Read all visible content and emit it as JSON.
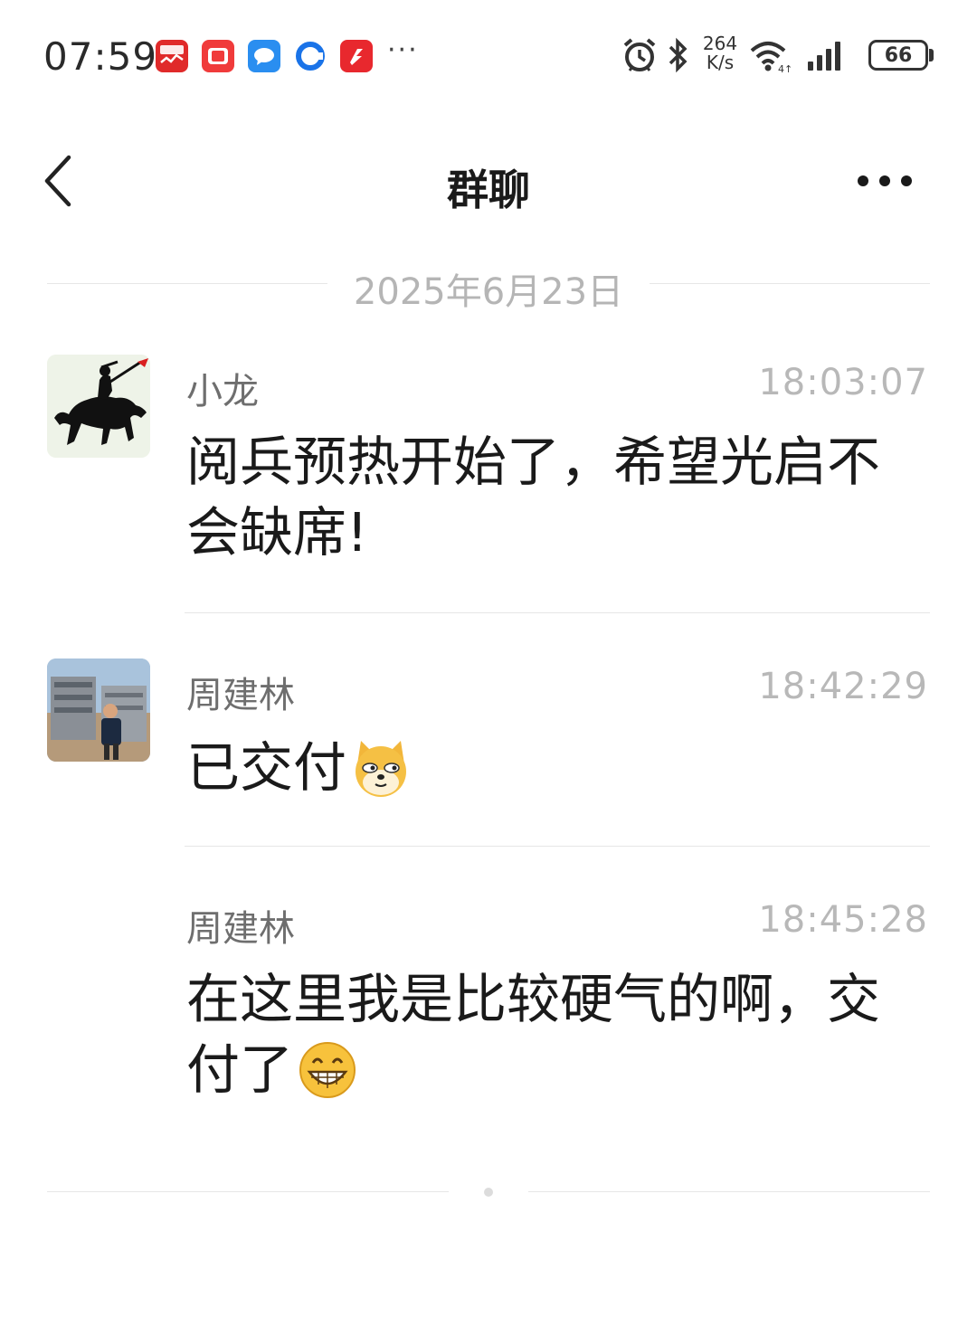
{
  "status_bar": {
    "time": "07:59",
    "net_speed_value": "264",
    "net_speed_unit": "K/s",
    "battery": "66",
    "more_notifications": "···",
    "app_icons": [
      {
        "name": "stock-app-icon",
        "color": "#e02a2a",
        "label": "选股"
      },
      {
        "name": "red-book-app-icon",
        "color": "#f03b3b",
        "label": ""
      },
      {
        "name": "message-app-icon",
        "color": "#2a8ef0",
        "label": ""
      },
      {
        "name": "browser-app-icon",
        "color": "#1a73e8",
        "label": ""
      },
      {
        "name": "news-app-icon",
        "color": "#e8282e",
        "label": ""
      }
    ]
  },
  "header": {
    "title": "群聊",
    "back_icon": "chevron-left-icon",
    "more_icon": "more-dots-icon"
  },
  "date_divider": "2025年6月23日",
  "messages": [
    {
      "sender": "小龙",
      "time": "18:03:07",
      "text": "阅兵预热开始了，希望光启不会缺席!",
      "avatar": "horse-rider-avatar"
    },
    {
      "sender": "周建林",
      "time": "18:42:29",
      "text": "已交付",
      "emoji": "doge-emoji",
      "avatar": "person-factory-avatar"
    },
    {
      "sender": "周建林",
      "time": "18:45:28",
      "text": "在这里我是比较硬气的啊，交付了",
      "emoji": "grin-emoji"
    }
  ]
}
